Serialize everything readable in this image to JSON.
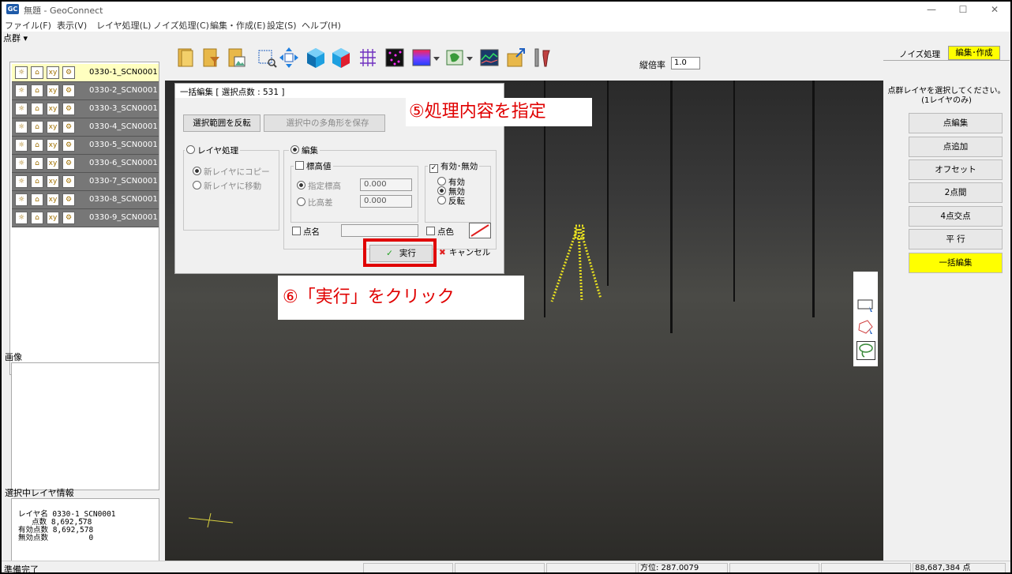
{
  "window": {
    "icon_text": "GC",
    "title": "無題 - GeoConnect",
    "minimize": "—",
    "maximize": "☐",
    "close": "✕"
  },
  "menu": [
    "ファイル(F)",
    "表示(V)",
    "レイヤ処理(L)",
    "ノイズ処理(C)",
    "編集・作成(E)",
    "設定(S)",
    "ヘルプ(H)"
  ],
  "left_panel": {
    "layer_header": "点群 ▾",
    "layers": [
      {
        "name": "0330-1_SCN0001",
        "selected": true
      },
      {
        "name": "0330-2_SCN0001",
        "selected": false
      },
      {
        "name": "0330-3_SCN0001",
        "selected": false
      },
      {
        "name": "0330-4_SCN0001",
        "selected": false
      },
      {
        "name": "0330-5_SCN0001",
        "selected": false
      },
      {
        "name": "0330-6_SCN0001",
        "selected": false
      },
      {
        "name": "0330-7_SCN0001",
        "selected": false
      },
      {
        "name": "0330-8_SCN0001",
        "selected": false
      },
      {
        "name": "0330-9_SCN0001",
        "selected": false
      }
    ],
    "layer_icons": [
      "bulb-icon",
      "lock-icon",
      "xyz-icon",
      "gear-icon"
    ],
    "image_label": "画像",
    "info_label": "選択中レイヤ情報",
    "info_lines": [
      "レイヤ名 0330-1_SCN0001",
      "   点数 8,692,578",
      "有効点数 8,692,578",
      "無効点数         0"
    ]
  },
  "toolbar": {
    "exaggeration_label": "縦倍率",
    "exaggeration_value": "1.0",
    "icons": [
      "open-folder-icon",
      "folder-filter-icon",
      "folder-image-icon",
      "zoom-rect-icon",
      "pan-icon",
      "cube-view-icon",
      "cube-red-icon",
      "grid-icon",
      "points-display-icon",
      "color-ramp-icon",
      "dropdown-icon",
      "map-icon",
      "dropdown-icon",
      "profile-icon",
      "export-icon",
      "tools-icon"
    ]
  },
  "dialog": {
    "title": "一括編集 [ 選択点数 : 531 ]",
    "invert_button": "選択範囲を反転",
    "save_polygon_button": "選択中の多角形を保存",
    "layer_group": {
      "label": "レイヤ処理",
      "options": [
        "新レイヤにコピー",
        "新レイヤに移動"
      ]
    },
    "edit_group": {
      "label": "編集",
      "elevation_group": {
        "label": "標高値",
        "options": [
          {
            "label": "指定標高",
            "value": "0.000"
          },
          {
            "label": "比高差",
            "value": "0.000"
          }
        ]
      },
      "validity_group": {
        "label": "有効･無効",
        "options": [
          "有効",
          "無効",
          "反転"
        ],
        "selected": "無効"
      },
      "point_name_label": "点名",
      "point_name_value": "",
      "point_color_label": "点色"
    },
    "execute_button": "実行",
    "cancel_button": "キャンセル"
  },
  "callouts": {
    "step5": "⑤処理内容を指定",
    "step6": "⑥「実行」をクリック"
  },
  "right_panel": {
    "tabs": [
      "ノイズ処理",
      "編集･作成"
    ],
    "active_tab": "編集･作成",
    "instruction": "点群レイヤを選択してください。",
    "instruction_sub": "(1レイヤのみ)",
    "buttons": [
      "点編集",
      "点追加",
      "オフセット",
      "2点間",
      "4点交点",
      "平 行",
      "一括編集"
    ],
    "active_button": "一括編集"
  },
  "mini_toolbar": [
    "rect-select-icon",
    "polygon-select-icon",
    "lasso-select-icon"
  ],
  "status": {
    "ready": "準備完了",
    "azimuth": "方位: 287.0079",
    "point_count": "88,687,384 点"
  },
  "colors": {
    "highlight_red": "#e00000",
    "active_yellow": "#ffff00",
    "selected_layer": "#ffffc0"
  }
}
